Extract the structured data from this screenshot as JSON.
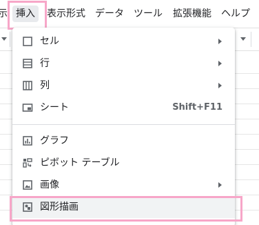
{
  "menubar": {
    "items": [
      {
        "label": "示",
        "name": "menubar-item-partial"
      },
      {
        "label": "挿入",
        "name": "menubar-item-insert"
      },
      {
        "label": "表示形式",
        "name": "menubar-item-format"
      },
      {
        "label": "データ",
        "name": "menubar-item-data"
      },
      {
        "label": "ツール",
        "name": "menubar-item-tools"
      },
      {
        "label": "拡張機能",
        "name": "menubar-item-extensions"
      },
      {
        "label": "ヘルプ",
        "name": "menubar-item-help"
      }
    ]
  },
  "insert_menu": {
    "items": [
      {
        "label": "セル",
        "icon": "cell-square-icon",
        "submenu": true
      },
      {
        "label": "行",
        "icon": "rows-icon",
        "submenu": true
      },
      {
        "label": "列",
        "icon": "columns-icon",
        "submenu": true
      },
      {
        "label": "シート",
        "icon": "sheet-icon",
        "shortcut": "Shift+F11"
      },
      {
        "label": "グラフ",
        "icon": "chart-icon"
      },
      {
        "label": "ピボット テーブル",
        "icon": "pivot-table-icon"
      },
      {
        "label": "画像",
        "icon": "image-icon",
        "submenu": true
      },
      {
        "label": "図形描画",
        "icon": "drawing-icon",
        "highlighted": true
      }
    ]
  },
  "colors": {
    "highlight": "#f7a6c8",
    "text": "#202124",
    "icon": "#5f6368",
    "hover_bg": "#f1f3f4"
  }
}
